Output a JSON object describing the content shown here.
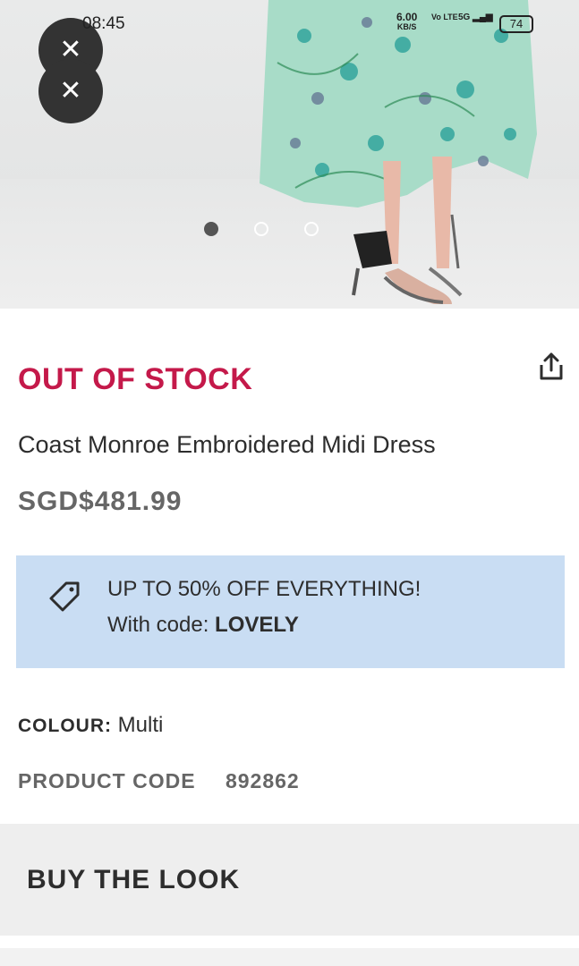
{
  "status_bar": {
    "time": "08:45",
    "net_speed": "6.00",
    "net_unit": "KB/S",
    "volte": "Vo LTE",
    "signal": "5G",
    "battery": "74"
  },
  "hero": {
    "close_icon": "close-icon",
    "carousel_dots": 3,
    "active_dot": 1
  },
  "product": {
    "stock_status": "OUT OF STOCK",
    "name": "Coast Monroe Embroidered Midi Dress",
    "price": "SGD$481.99",
    "share_icon": "share-icon"
  },
  "promo": {
    "line1": "UP TO 50% OFF EVERYTHING!",
    "line2_prefix": "With code: ",
    "code": "LOVELY",
    "icon": "tag-icon"
  },
  "details": {
    "colour_label": "COLOUR:",
    "colour_value": "Multi",
    "product_code_label": "PRODUCT CODE",
    "product_code_value": "892862"
  },
  "buy_the_look": {
    "title": "BUY THE LOOK"
  },
  "colors": {
    "accent": "#c4194a",
    "promo_bg": "#c9ddf3",
    "section_bg": "#eeeeee"
  }
}
